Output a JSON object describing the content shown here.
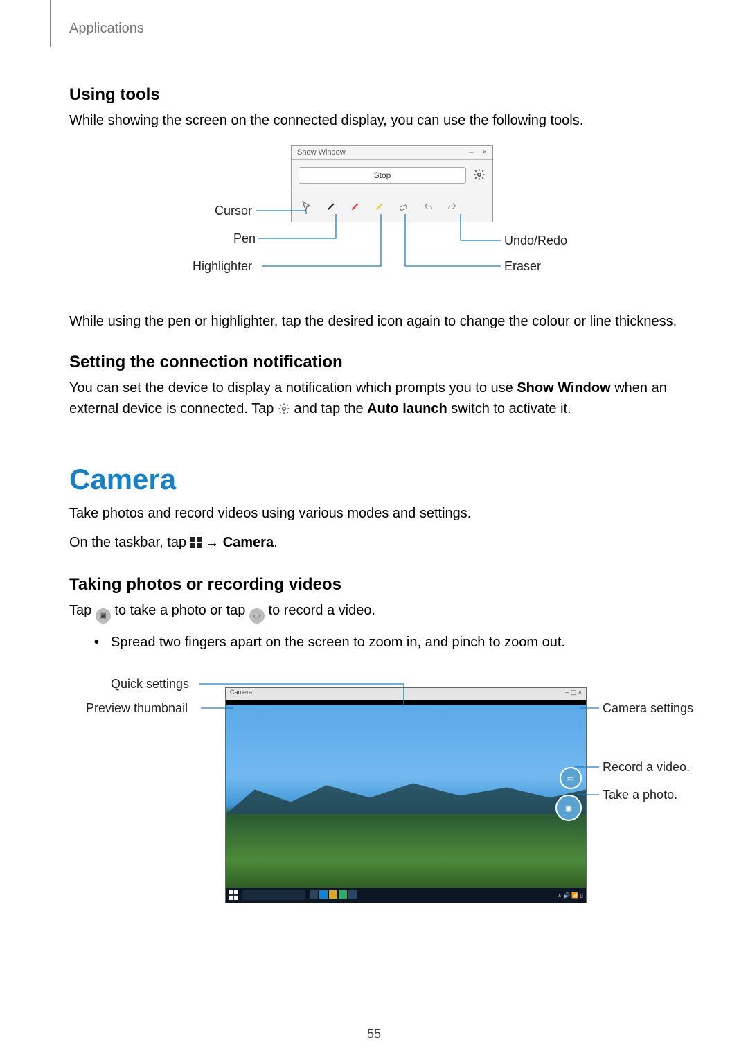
{
  "header": {
    "section": "Applications"
  },
  "s1": {
    "heading": "Using tools",
    "intro": "While showing the screen on the connected display, you can use the following tools.",
    "note": "While using the pen or highlighter, tap the desired icon again to change the colour or line thickness."
  },
  "showwin": {
    "title": "Show Window",
    "stop": "Stop",
    "labels": {
      "cursor": "Cursor",
      "pen": "Pen",
      "highlighter": "Highlighter",
      "undoredo": "Undo/Redo",
      "eraser": "Eraser"
    }
  },
  "s2": {
    "heading": "Setting the connection notification",
    "p_part1": "You can set the device to display a notification which prompts you to use ",
    "p_bold1": "Show Window",
    "p_part2": " when an external device is connected. Tap ",
    "p_part3": " and tap the ",
    "p_bold2": "Auto launch",
    "p_part4": " switch to activate it."
  },
  "camera": {
    "title": "Camera",
    "intro": "Take photos and record videos using various modes and settings.",
    "taskbar_pre": "On the taskbar, tap ",
    "taskbar_arrow": " → ",
    "taskbar_bold": "Camera",
    "taskbar_post": "."
  },
  "s3": {
    "heading": "Taking photos or recording videos",
    "tap_pre": "Tap ",
    "tap_mid": " to take a photo or tap ",
    "tap_post": " to record a video.",
    "bullet": "Spread two fingers apart on the screen to zoom in, and pinch to zoom out."
  },
  "cam_illus": {
    "app_title": "Camera",
    "labels": {
      "quick": "Quick settings",
      "preview": "Preview thumbnail",
      "settings": "Camera settings",
      "record": "Record a video.",
      "photo": "Take a photo."
    }
  },
  "page_number": "55"
}
